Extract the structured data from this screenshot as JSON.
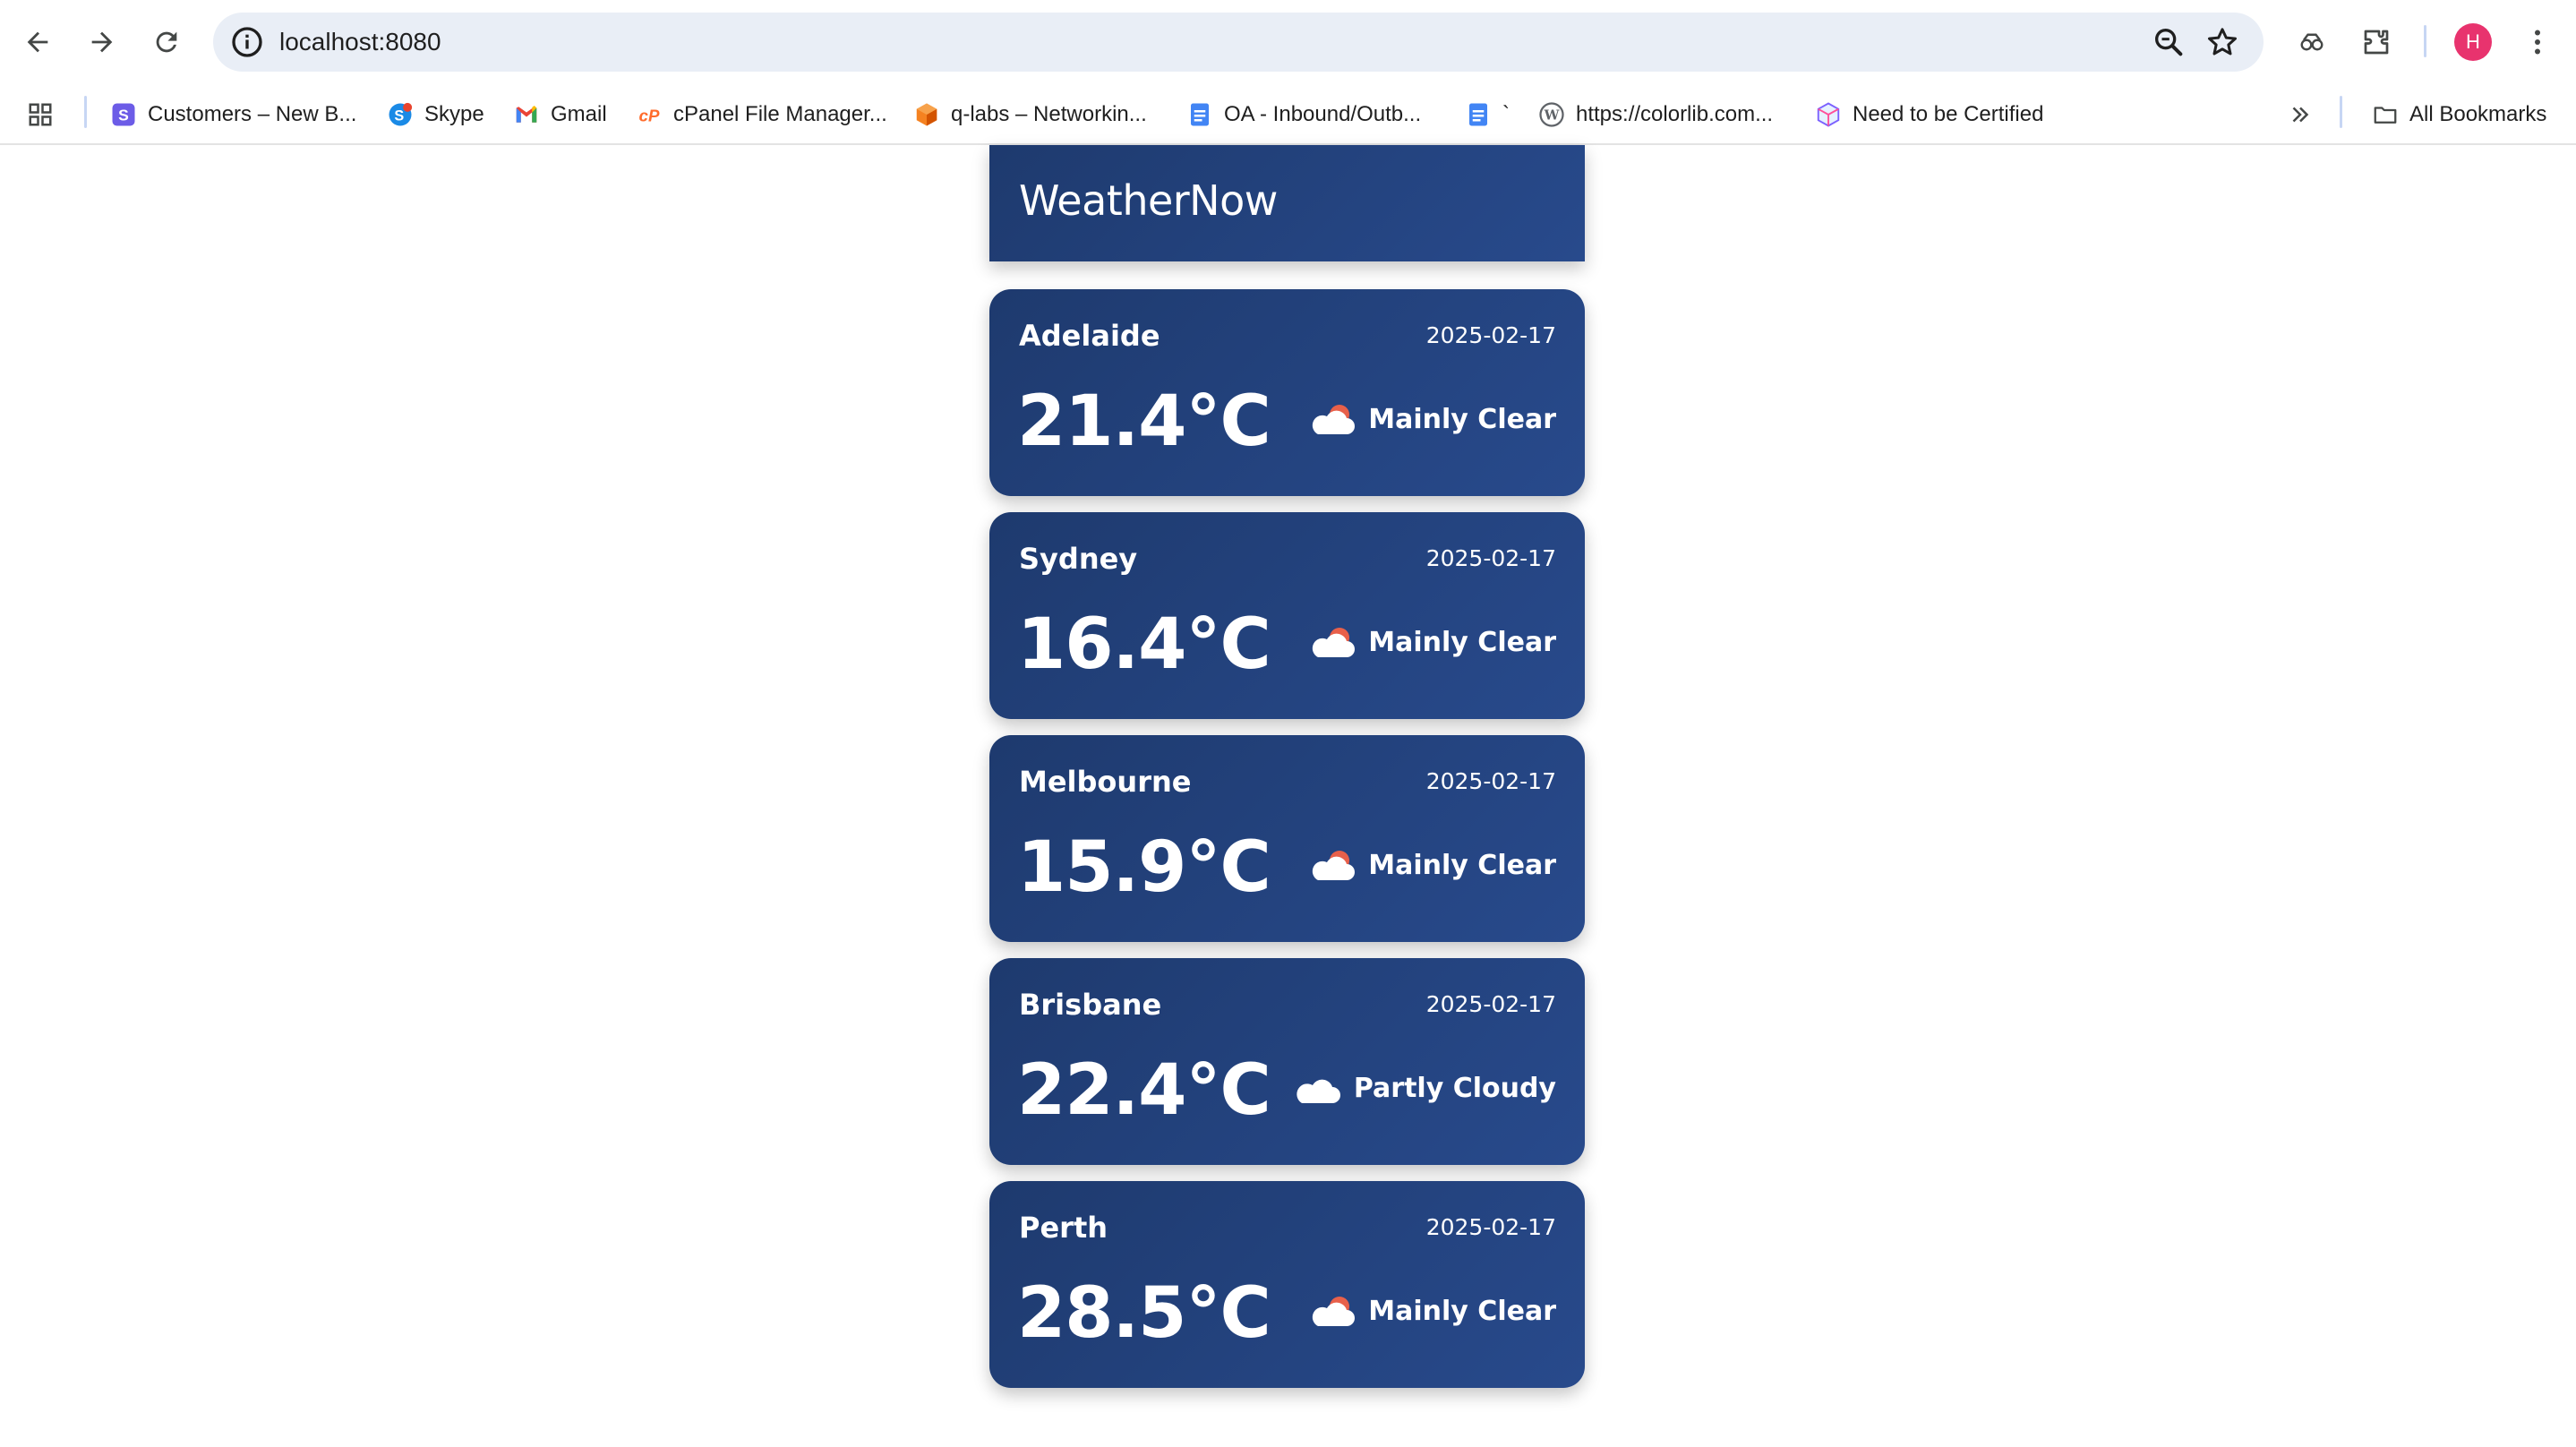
{
  "browser": {
    "url": "localhost:8080",
    "profile_initial": "H",
    "accent": "#e8336e"
  },
  "bookmarks": {
    "items": [
      {
        "label": "Customers – New B...",
        "icon": "s-icon"
      },
      {
        "label": "Skype",
        "icon": "skype-icon"
      },
      {
        "label": "Gmail",
        "icon": "gmail-icon"
      },
      {
        "label": "cPanel File Manager...",
        "icon": "cpanel-icon"
      },
      {
        "label": "q-labs – Networkin...",
        "icon": "cube-icon"
      },
      {
        "label": "OA - Inbound/Outb...",
        "icon": "docs-icon"
      },
      {
        "label": "`",
        "icon": "docs-icon"
      },
      {
        "label": "https://colorlib.com...",
        "icon": "wordpress-icon"
      },
      {
        "label": "Need to be Certified",
        "icon": "box-icon"
      }
    ],
    "all_label": "All Bookmarks"
  },
  "app": {
    "title": "WeatherNow",
    "card_gradient": [
      "#1e3a6e",
      "#284a8c"
    ]
  },
  "cities": [
    {
      "city": "Adelaide",
      "date": "2025-02-17",
      "temp": "21.4°C",
      "condition": "Mainly Clear",
      "icon": "cloud-sun-icon"
    },
    {
      "city": "Sydney",
      "date": "2025-02-17",
      "temp": "16.4°C",
      "condition": "Mainly Clear",
      "icon": "cloud-sun-icon"
    },
    {
      "city": "Melbourne",
      "date": "2025-02-17",
      "temp": "15.9°C",
      "condition": "Mainly Clear",
      "icon": "cloud-sun-icon"
    },
    {
      "city": "Brisbane",
      "date": "2025-02-17",
      "temp": "22.4°C",
      "condition": "Partly Cloudy",
      "icon": "cloud-icon"
    },
    {
      "city": "Perth",
      "date": "2025-02-17",
      "temp": "28.5°C",
      "condition": "Mainly Clear",
      "icon": "cloud-sun-icon"
    }
  ]
}
